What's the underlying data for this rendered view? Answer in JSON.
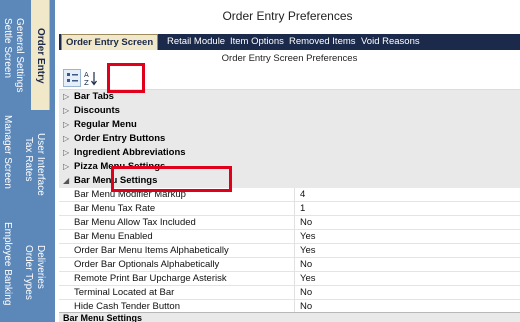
{
  "sidebar": {
    "columns": [
      {
        "items": [
          "Settle Screen",
          "General Settings"
        ]
      },
      {
        "items": [
          "Order Entry"
        ]
      },
      {
        "items": [
          "Manager Screen"
        ]
      },
      {
        "items": [
          "Tax Rates",
          "User Interface"
        ]
      },
      {
        "items": [
          "Employee Banking"
        ]
      },
      {
        "items": [
          "Order Types",
          "Deliveries"
        ]
      }
    ]
  },
  "window": {
    "title": "Order Entry Preferences"
  },
  "tabs": [
    "Order Entry Screen",
    "Retail Module",
    "Item Options",
    "Removed Items",
    "Void Reasons"
  ],
  "panel": {
    "subtitle": "Order Entry Screen Preferences"
  },
  "categories": [
    "Bar Tabs",
    "Discounts",
    "Regular Menu",
    "Order Entry Buttons",
    "Ingredient Abbreviations",
    "Pizza Menu Settings",
    "Bar Menu Settings"
  ],
  "properties": [
    {
      "name": "Bar Menu Modifier Markup",
      "value": "4"
    },
    {
      "name": "Bar Menu Tax Rate",
      "value": "1"
    },
    {
      "name": "Bar Menu Allow Tax Included",
      "value": "No"
    },
    {
      "name": "Bar Menu Enabled",
      "value": "Yes"
    },
    {
      "name": "Order Bar Menu Items Alphabetically",
      "value": "Yes"
    },
    {
      "name": "Order Bar Optionals Alphabetically",
      "value": "No"
    },
    {
      "name": "Remote Print Bar Upcharge Asterisk",
      "value": "Yes"
    },
    {
      "name": "Terminal Located at Bar",
      "value": "No"
    },
    {
      "name": "Hide Cash Tender Button",
      "value": "No"
    }
  ],
  "footer": {
    "label": "Bar Menu Settings"
  },
  "colors": {
    "sidebar": "#5b87b9",
    "tabstrip": "#1b2a4a",
    "active_tab": "#f1e7c9",
    "highlight": "#e0001b"
  },
  "icons": {
    "categorized": "categorized-view-icon",
    "sort": "alphabetical-sort-icon"
  }
}
